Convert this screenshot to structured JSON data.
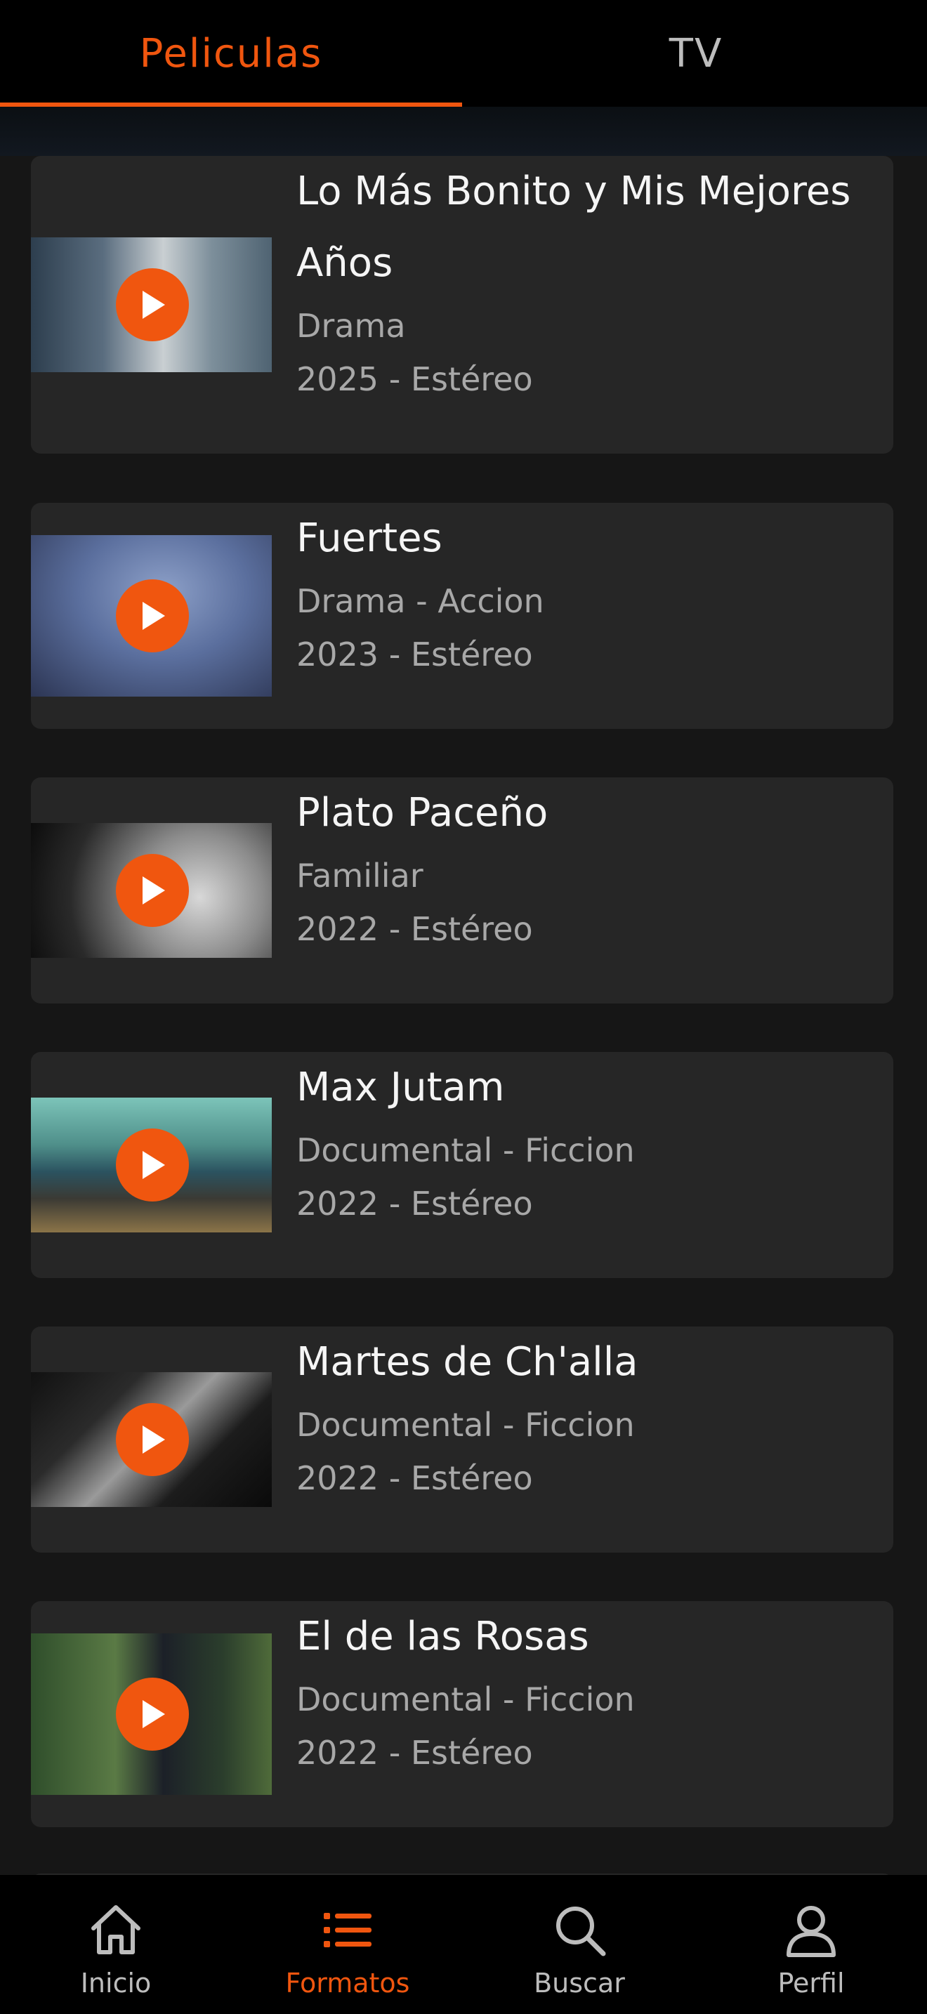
{
  "tabs": {
    "peliculas": "Peliculas",
    "tv": "TV"
  },
  "accent_color": "#f0560f",
  "movies": [
    {
      "title": "Lo Más Bonito y Mis Mejores Años",
      "genre": "Drama",
      "meta": "2025 - Estéreo"
    },
    {
      "title": "Fuertes",
      "genre": "Drama - Accion",
      "meta": "2023 - Estéreo"
    },
    {
      "title": "Plato Paceño",
      "genre": "Familiar",
      "meta": "2022 - Estéreo"
    },
    {
      "title": "Max Jutam",
      "genre": "Documental - Ficcion",
      "meta": "2022 - Estéreo"
    },
    {
      "title": "Martes de Ch'alla",
      "genre": "Documental - Ficcion",
      "meta": "2022 - Estéreo"
    },
    {
      "title": "El de las Rosas",
      "genre": "Documental - Ficcion",
      "meta": "2022 - Estéreo"
    }
  ],
  "bottom_nav": {
    "inicio": "Inicio",
    "formatos": "Formatos",
    "buscar": "Buscar",
    "perfil": "Perfil"
  },
  "icons": {
    "inicio": "home-icon",
    "formatos": "list-icon",
    "buscar": "search-icon",
    "perfil": "user-icon",
    "play": "play-icon"
  }
}
